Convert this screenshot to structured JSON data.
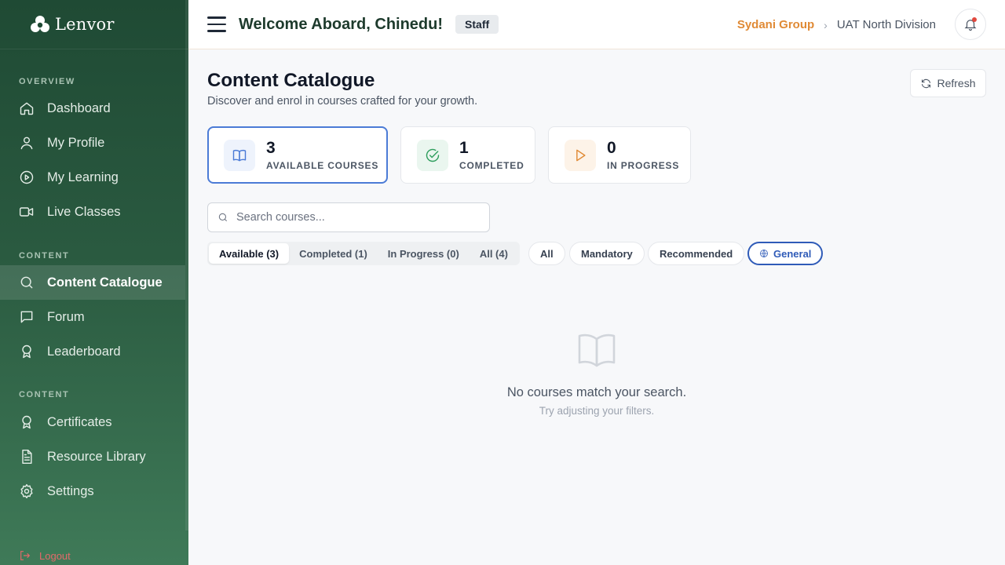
{
  "brand": {
    "name": "Lenvor"
  },
  "sidebar": {
    "sections": [
      {
        "label": "OVERVIEW"
      },
      {
        "label": "CONTENT"
      },
      {
        "label": "CONTENT"
      }
    ],
    "items": [
      {
        "label": "Dashboard",
        "icon": "home-icon"
      },
      {
        "label": "My Profile",
        "icon": "user-icon"
      },
      {
        "label": "My Learning",
        "icon": "play-circle-icon"
      },
      {
        "label": "Live Classes",
        "icon": "video-icon"
      },
      {
        "label": "Content Catalogue",
        "icon": "search-icon",
        "active": true
      },
      {
        "label": "Forum",
        "icon": "chat-icon"
      },
      {
        "label": "Leaderboard",
        "icon": "award-icon"
      },
      {
        "label": "Certificates",
        "icon": "award-icon"
      },
      {
        "label": "Resource Library",
        "icon": "document-icon"
      },
      {
        "label": "Settings",
        "icon": "gear-icon"
      }
    ],
    "logout_label": "Logout"
  },
  "header": {
    "welcome": "Welcome Aboard, Chinedu!",
    "role": "Staff",
    "breadcrumb": {
      "org": "Sydani Group",
      "division": "UAT North Division"
    }
  },
  "main": {
    "title": "Content Catalogue",
    "subtitle": "Discover and enrol in courses crafted for your growth.",
    "refresh_label": "Refresh",
    "stats": [
      {
        "value": "3",
        "label": "AVAILABLE COURSES",
        "icon": "book-icon",
        "color": "#4b7bd6"
      },
      {
        "value": "1",
        "label": "COMPLETED",
        "icon": "check-circle-icon",
        "color": "#2f9e5e"
      },
      {
        "value": "0",
        "label": "IN PROGRESS",
        "icon": "play-icon",
        "color": "#e08a35"
      }
    ],
    "search": {
      "placeholder": "Search courses...",
      "value": ""
    },
    "tabs": [
      {
        "label": "Available (3)",
        "active": true
      },
      {
        "label": "Completed (1)"
      },
      {
        "label": "In Progress (0)"
      },
      {
        "label": "All (4)"
      }
    ],
    "filters": [
      {
        "label": "All"
      },
      {
        "label": "Mandatory"
      },
      {
        "label": "Recommended"
      },
      {
        "label": "General",
        "icon": "globe-icon",
        "active": true
      }
    ],
    "empty": {
      "title": "No courses match your search.",
      "subtitle": "Try adjusting your filters."
    }
  },
  "colors": {
    "accent": "#2f5bb8",
    "sidebar": "#1f4a34",
    "org": "#e08a35"
  }
}
